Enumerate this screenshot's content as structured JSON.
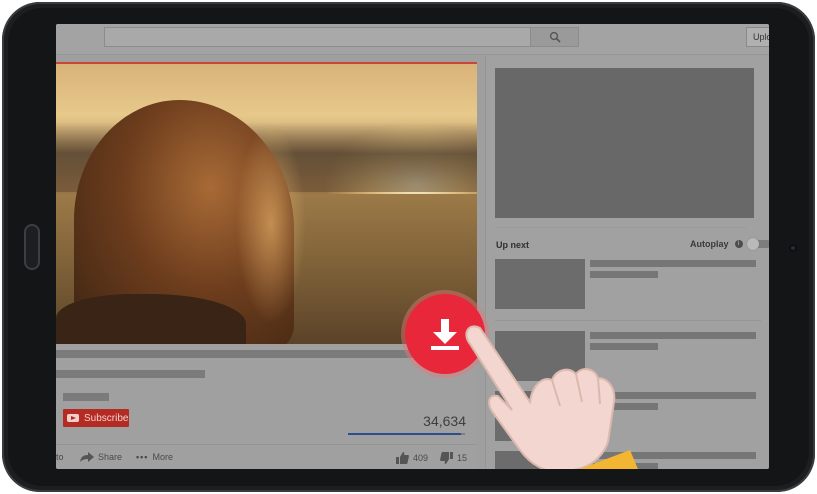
{
  "header": {
    "search_placeholder": "",
    "upload_label": "Uplo"
  },
  "video": {
    "subscribe_label": "Subscribe",
    "view_count": "34,634",
    "like_ratio": 0.964,
    "actions": {
      "save_partial": "to",
      "share": "Share",
      "more": "More",
      "likes": "409",
      "dislikes": "15"
    }
  },
  "sidebar": {
    "up_next": "Up next",
    "autoplay": "Autoplay",
    "autoplay_enabled": false
  },
  "overlay": {
    "download_icon": "download-icon",
    "accent": "#e8283a"
  },
  "colors": {
    "subscribe": "#b32b22",
    "like_bar": "#2a4f8a"
  }
}
